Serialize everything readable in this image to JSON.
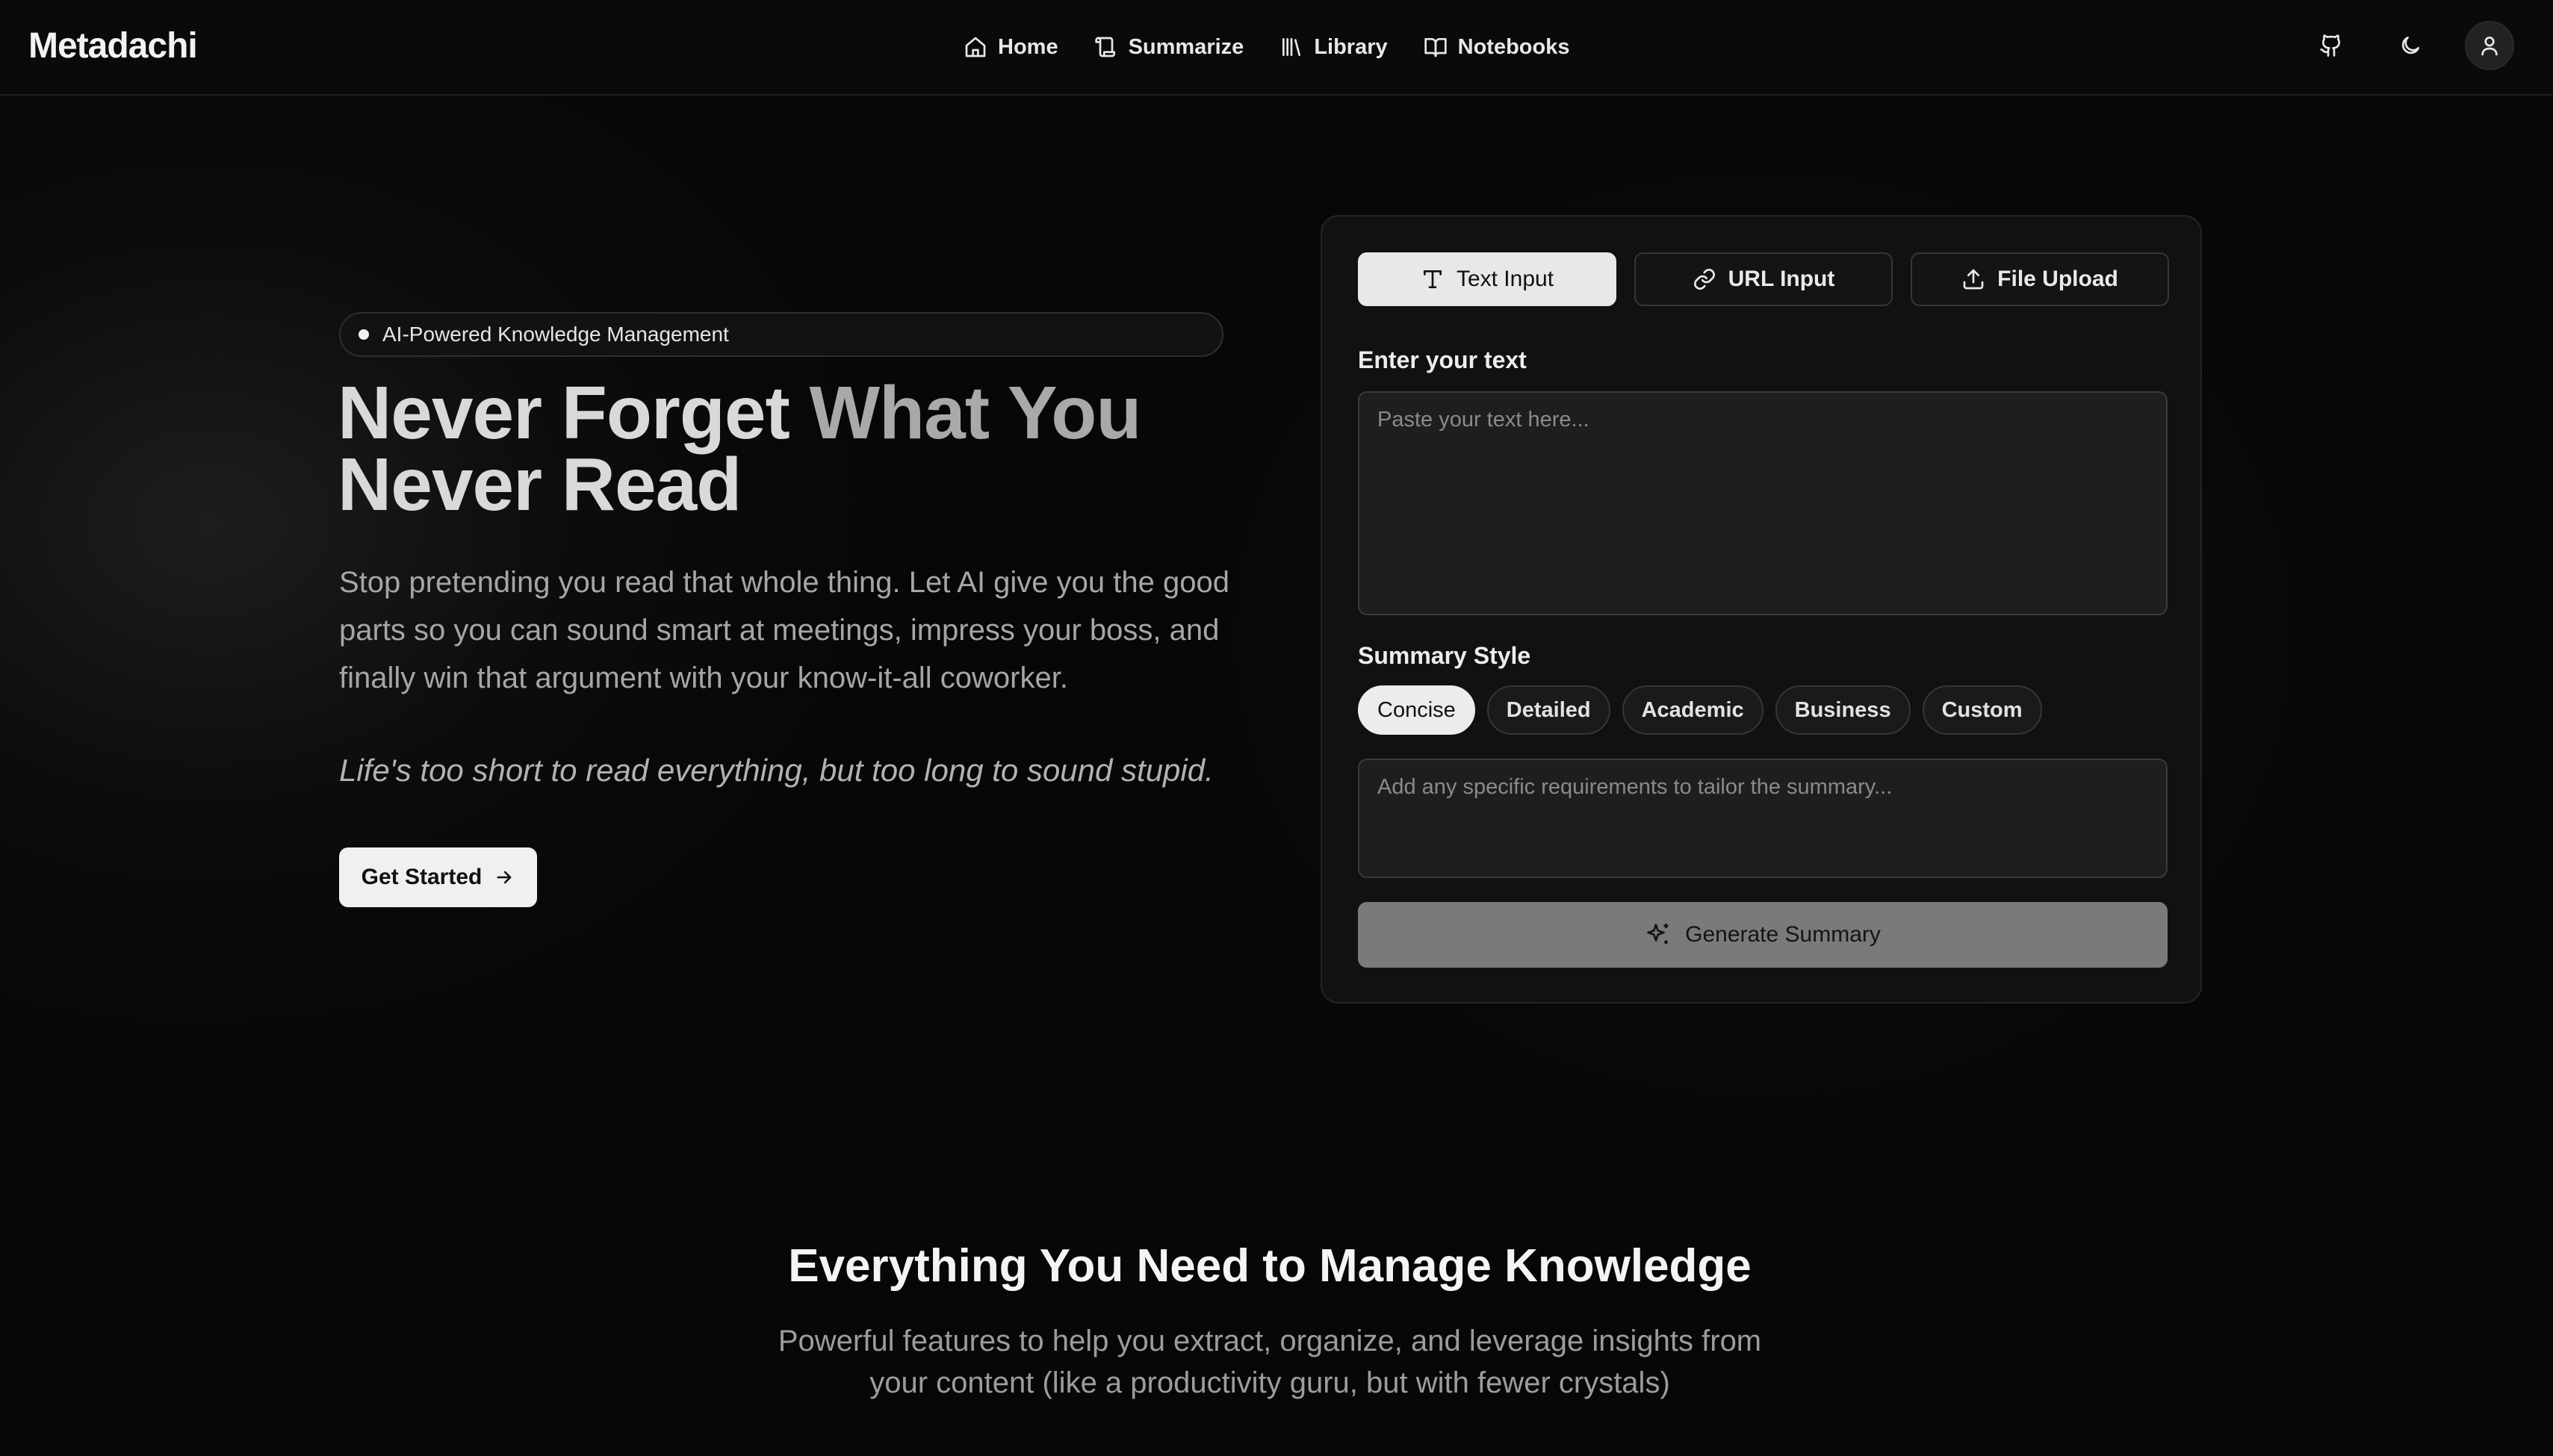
{
  "header": {
    "logo": "Metadachi",
    "nav": [
      {
        "label": "Home",
        "icon": "home-icon"
      },
      {
        "label": "Summarize",
        "icon": "scroll-icon"
      },
      {
        "label": "Library",
        "icon": "library-icon"
      },
      {
        "label": "Notebooks",
        "icon": "book-icon"
      }
    ],
    "actions": [
      "github-icon",
      "moon-icon",
      "user-icon"
    ]
  },
  "hero": {
    "badge": "AI-Powered Knowledge Management",
    "title_part1": "Never Forget ",
    "title_part2": "What You",
    "title_part3": "Never Read",
    "description": "Stop pretending you read that whole thing. Let AI give you the good parts so you can sound smart at meetings, impress your boss, and finally win that argument with your know-it-all coworker.",
    "quote": "Life's too short to read everything, but too long to sound stupid.",
    "cta": "Get Started"
  },
  "summarizer": {
    "tabs": [
      {
        "label": "Text Input",
        "icon": "type-icon",
        "active": true
      },
      {
        "label": "URL Input",
        "icon": "link-icon",
        "active": false
      },
      {
        "label": "File Upload",
        "icon": "upload-icon",
        "active": false
      }
    ],
    "text_label": "Enter your text",
    "text_placeholder": "Paste your text here...",
    "style_label": "Summary Style",
    "styles": [
      {
        "label": "Concise",
        "active": true
      },
      {
        "label": "Detailed",
        "active": false
      },
      {
        "label": "Academic",
        "active": false
      },
      {
        "label": "Business",
        "active": false
      },
      {
        "label": "Custom",
        "active": false
      }
    ],
    "requirements_placeholder": "Add any specific requirements to tailor the summary...",
    "generate_label": "Generate Summary"
  },
  "features": {
    "title": "Everything You Need to Manage Knowledge",
    "subtitle_line1": "Powerful features to help you extract, organize, and leverage insights from",
    "subtitle_line2": "your content (like a productivity guru, but with fewer crystals)"
  }
}
